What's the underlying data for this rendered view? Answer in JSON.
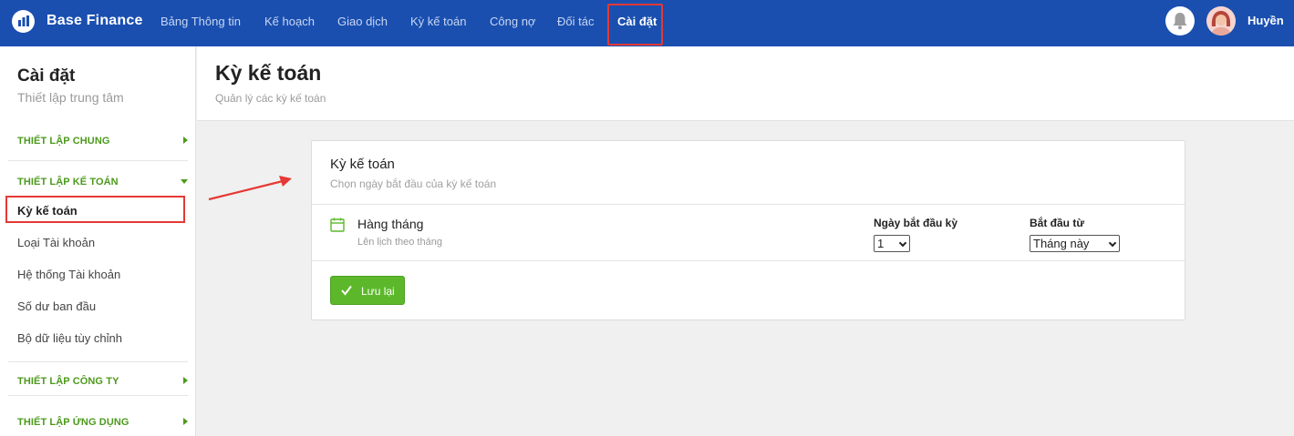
{
  "app": {
    "name": "Base Finance"
  },
  "nav": {
    "items": [
      "Bảng Thông tin",
      "Kế hoạch",
      "Giao dịch",
      "Kỳ kế toán",
      "Công nợ",
      "Đối tác",
      "Cài đặt"
    ],
    "active": "Cài đặt"
  },
  "user": {
    "name": "Huyền"
  },
  "sidebar": {
    "title": "Cài đặt",
    "subtitle": "Thiết lập trung tâm",
    "sections": {
      "general": "THIẾT LẬP CHUNG",
      "accounting": "THIẾT LẬP KẾ TOÁN",
      "company": "THIẾT LẬP CÔNG TY",
      "app": "THIẾT LẬP ỨNG DỤNG"
    },
    "items": [
      "Kỳ kế toán",
      "Loại Tài khoản",
      "Hệ thống Tài khoản",
      "Số dư ban đầu",
      "Bộ dữ liệu tùy chỉnh"
    ]
  },
  "page": {
    "title": "Kỳ kế toán",
    "subtitle": "Quản lý các kỳ kế toán"
  },
  "card": {
    "title": "Kỳ kế toán",
    "subtitle": "Chọn ngày bắt đầu của kỳ kế toán",
    "option_title": "Hàng tháng",
    "option_subtitle": "Lên lịch theo tháng",
    "start_day_label": "Ngày bắt đầu kỳ",
    "start_day_value": "1",
    "start_from_label": "Bắt đầu từ",
    "start_from_value": "Tháng này",
    "save_label": "Lưu lại"
  },
  "colors": {
    "topbar": "#1a4fb0",
    "accent_green": "#5cb82a",
    "section_green": "#4c9a1c",
    "highlight_red": "#e53935"
  }
}
